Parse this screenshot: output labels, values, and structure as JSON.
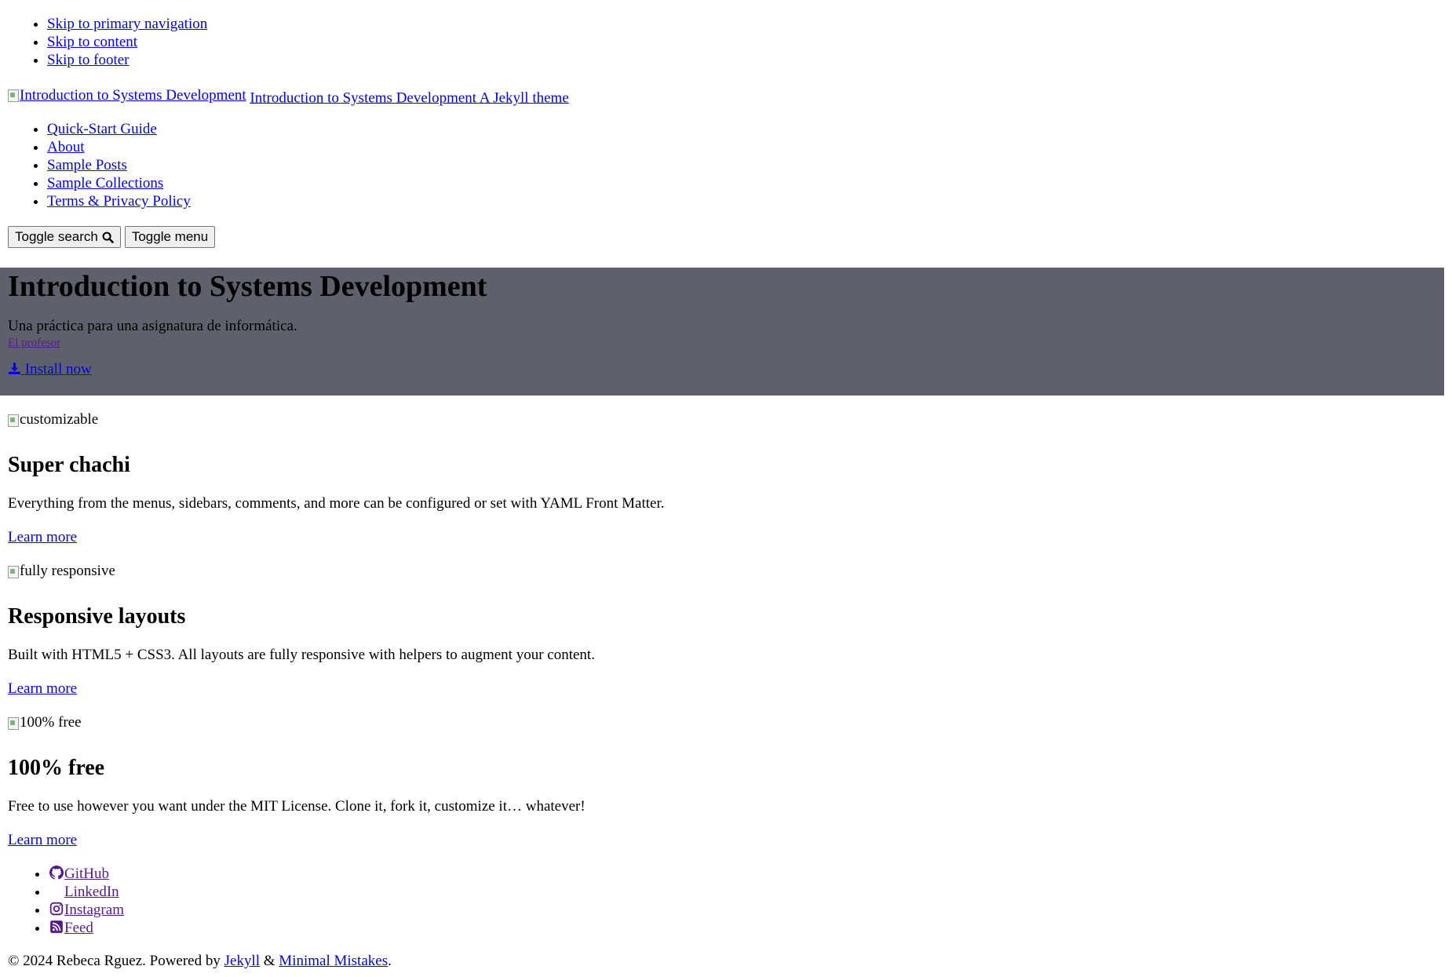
{
  "skip_links": [
    "Skip to primary navigation",
    "Skip to content",
    "Skip to footer"
  ],
  "masthead": {
    "logo_alt": "Introduction to Systems Development",
    "site_title": "Introduction to Systems Development",
    "site_subtitle": "A Jekyll theme"
  },
  "nav": [
    "Quick-Start Guide",
    "About",
    "Sample Posts",
    "Sample Collections",
    "Terms & Privacy Policy"
  ],
  "buttons": {
    "search": "Toggle search",
    "menu": "Toggle menu"
  },
  "hero": {
    "title": "Introduction to Systems Development",
    "tagline": "Una práctica para una asignatura de informática.",
    "author_link": "El profesor",
    "install": "Install now",
    "background": "#5e616c"
  },
  "features": [
    {
      "image_alt": "customizable",
      "title": "Super chachi",
      "text": "Everything from the menus, sidebars, comments, and more can be configured or set with YAML Front Matter.",
      "link": "Learn more"
    },
    {
      "image_alt": "fully responsive",
      "title": "Responsive layouts",
      "text": "Built with HTML5 + CSS3. All layouts are fully responsive with helpers to augment your content.",
      "link": "Learn more"
    },
    {
      "image_alt": "100% free",
      "title": "100% free",
      "text": "Free to use however you want under the MIT License. Clone it, fork it, customize it… whatever!",
      "link": "Learn more"
    }
  ],
  "social": [
    {
      "label": "GitHub",
      "icon": "github-icon"
    },
    {
      "label": "LinkedIn",
      "icon": "linkedin-icon"
    },
    {
      "label": "Instagram",
      "icon": "instagram-icon"
    },
    {
      "label": "Feed",
      "icon": "rss-icon"
    }
  ],
  "footer": {
    "copyright_prefix": "© 2024 Rebeca Rguez. Powered by",
    "jekyll": "Jekyll",
    "amp": "&",
    "mm": "Minimal Mistakes",
    "period": "."
  },
  "colors": {
    "link": "#0000ee",
    "visited": "#551a8b",
    "hero_bg": "#5e616c"
  }
}
